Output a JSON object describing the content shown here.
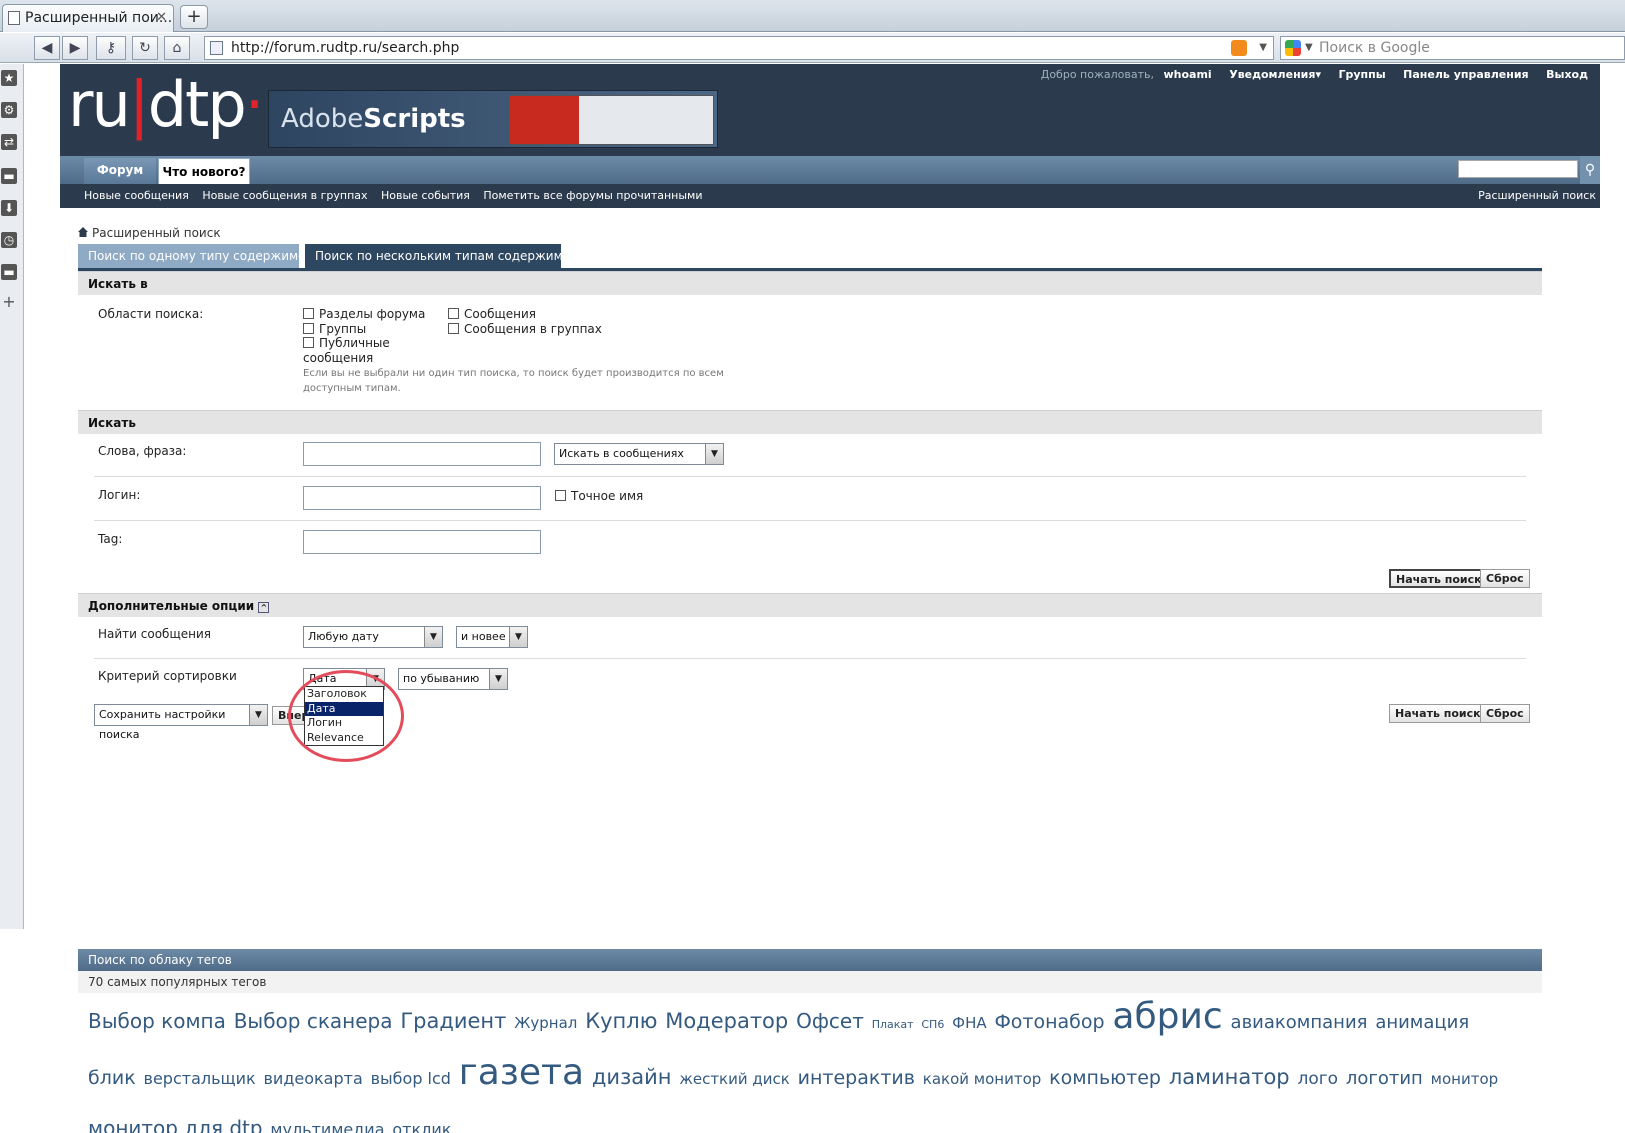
{
  "browser": {
    "tab_title": "Расширенный пои...",
    "url": "http://forum.rudtp.ru/search.php",
    "search_placeholder": "Поиск в Google"
  },
  "header": {
    "logo_ru": "ru",
    "logo_dtp": "dtp",
    "banner_adobe": "Adobe",
    "banner_scripts": "Scripts",
    "welcome": "Добро пожаловать,",
    "username": "whoami",
    "links": [
      "Уведомления▾",
      "Группы",
      "Панель управления",
      "Выход"
    ]
  },
  "nav": {
    "tabs": [
      "Форум",
      "Что нового?"
    ],
    "sub": [
      "Новые сообщения",
      "Новые сообщения в группах",
      "Новые события",
      "Пометить все форумы прочитанными"
    ],
    "advanced": "Расширенный поиск"
  },
  "breadcrumb": "Расширенный поиск",
  "search_tabs": [
    "Поиск по одному типу содержимого",
    "Поиск по нескольким типам содержимого"
  ],
  "search_in": {
    "heading": "Искать в",
    "label": "Области поиска:",
    "options_col1": [
      "Разделы форума",
      "Группы",
      "Публичные",
      "сообщения"
    ],
    "options_col2": [
      "Сообщения",
      "Сообщения в группах"
    ],
    "hint": "Если вы не выбрали ни один тип поиска, то поиск будет производится по всем доступным типам."
  },
  "search": {
    "heading": "Искать",
    "words_label": "Слова, фраза:",
    "scope_select": "Искать в сообщениях",
    "login_label": "Логин:",
    "exact_name": "Точное имя",
    "tag_label": "Tag:",
    "start_button": "Начать поиск",
    "reset_button": "Сброс"
  },
  "extra": {
    "heading": "Дополнительные опции",
    "find_label": "Найти сообщения",
    "date_select": "Любую дату",
    "newer_select": "и новее",
    "sort_label": "Критерий сортировки",
    "sort_select": "Дата",
    "order_select": "по убыванию",
    "sort_options": [
      "Заголовок",
      "Дата",
      "Логин",
      "Relevance"
    ],
    "save_select": "Сохранить настройки поиска",
    "go_button": "Впер"
  },
  "tags": {
    "heading": "Поиск по облаку тегов",
    "subheading": "70 самых популярных тегов",
    "cloud": [
      {
        "t": "Выбор компа",
        "s": 20
      },
      {
        "t": "Выбор сканера",
        "s": 20
      },
      {
        "t": "Градиент",
        "s": 21
      },
      {
        "t": "Журнал",
        "s": 15
      },
      {
        "t": "Куплю",
        "s": 21
      },
      {
        "t": "Модератор",
        "s": 21
      },
      {
        "t": "Офсет",
        "s": 20
      },
      {
        "t": "Плакат",
        "s": 11
      },
      {
        "t": "СП6",
        "s": 11
      },
      {
        "t": "ФНА",
        "s": 15
      },
      {
        "t": "Фотонабор",
        "s": 19
      },
      {
        "t": "абрис",
        "s": 36
      },
      {
        "t": "авиакомпания",
        "s": 18
      },
      {
        "t": "анимация",
        "s": 18
      },
      {
        "t": "блик",
        "s": 19
      },
      {
        "t": "верстальщик",
        "s": 16
      },
      {
        "t": "видеокарта",
        "s": 16
      },
      {
        "t": "выбор lcd",
        "s": 16
      },
      {
        "t": "газета",
        "s": 36
      },
      {
        "t": "дизайн",
        "s": 21
      },
      {
        "t": "жесткий диск",
        "s": 15
      },
      {
        "t": "интерактив",
        "s": 19
      },
      {
        "t": "какой монитор",
        "s": 15
      },
      {
        "t": "компьютер",
        "s": 19
      },
      {
        "t": "ламинатор",
        "s": 21
      },
      {
        "t": "лого",
        "s": 17
      },
      {
        "t": "логотип",
        "s": 18
      },
      {
        "t": "монитор",
        "s": 15
      },
      {
        "t": "монитор для dtp",
        "s": 20
      },
      {
        "t": "мультимедиа",
        "s": 16
      },
      {
        "t": "отклик",
        "s": 16
      }
    ]
  }
}
